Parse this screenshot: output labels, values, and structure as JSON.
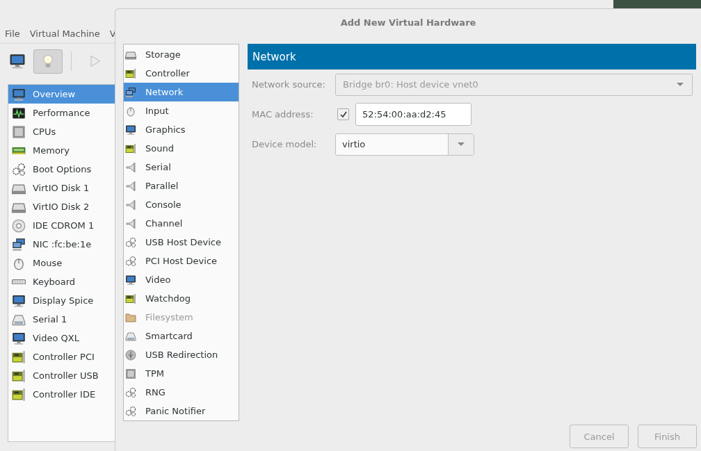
{
  "menu_bar": [
    {
      "label": "File"
    },
    {
      "label": "Virtual Machine"
    },
    {
      "label": "V"
    }
  ],
  "toolbar": [
    {
      "kind": "monitor",
      "selected": false,
      "disabled": false
    },
    {
      "kind": "bulb",
      "selected": true,
      "disabled": false
    },
    {
      "kind": "play",
      "selected": false,
      "disabled": true
    }
  ],
  "sidebar": {
    "items": [
      {
        "label": "Overview",
        "kind": "monitor",
        "selected": true
      },
      {
        "label": "Performance",
        "kind": "chart",
        "selected": false
      },
      {
        "label": "CPUs",
        "kind": "chip",
        "selected": false
      },
      {
        "label": "Memory",
        "kind": "memory",
        "selected": false
      },
      {
        "label": "Boot Options",
        "kind": "gears",
        "selected": false
      },
      {
        "label": "VirtIO Disk 1",
        "kind": "disk",
        "selected": false
      },
      {
        "label": "VirtIO Disk 2",
        "kind": "disk",
        "selected": false
      },
      {
        "label": "IDE CDROM 1",
        "kind": "disc",
        "selected": false
      },
      {
        "label": "NIC :fc:be:1e",
        "kind": "nic",
        "selected": false
      },
      {
        "label": "Mouse",
        "kind": "mouse",
        "selected": false
      },
      {
        "label": "Keyboard",
        "kind": "keyboard",
        "selected": false
      },
      {
        "label": "Display Spice",
        "kind": "monitor",
        "selected": false
      },
      {
        "label": "Serial 1",
        "kind": "serial",
        "selected": false
      },
      {
        "label": "Video QXL",
        "kind": "monitor",
        "selected": false
      },
      {
        "label": "Controller PCI",
        "kind": "card",
        "selected": false
      },
      {
        "label": "Controller USB",
        "kind": "card",
        "selected": false
      },
      {
        "label": "Controller IDE",
        "kind": "card",
        "selected": false
      }
    ]
  },
  "dialog": {
    "title": "Add New Virtual Hardware",
    "device_list": {
      "items": [
        {
          "label": "Storage",
          "kind": "disk",
          "selected": false,
          "disabled": false
        },
        {
          "label": "Controller",
          "kind": "card",
          "selected": false,
          "disabled": false
        },
        {
          "label": "Network",
          "kind": "nic",
          "selected": true,
          "disabled": false
        },
        {
          "label": "Input",
          "kind": "mouse",
          "selected": false,
          "disabled": false
        },
        {
          "label": "Graphics",
          "kind": "monitor",
          "selected": false,
          "disabled": false
        },
        {
          "label": "Sound",
          "kind": "card",
          "selected": false,
          "disabled": false
        },
        {
          "label": "Serial",
          "kind": "plug",
          "selected": false,
          "disabled": false
        },
        {
          "label": "Parallel",
          "kind": "plug",
          "selected": false,
          "disabled": false
        },
        {
          "label": "Console",
          "kind": "plug",
          "selected": false,
          "disabled": false
        },
        {
          "label": "Channel",
          "kind": "plug",
          "selected": false,
          "disabled": false
        },
        {
          "label": "USB Host Device",
          "kind": "gears",
          "selected": false,
          "disabled": false
        },
        {
          "label": "PCI Host Device",
          "kind": "gears",
          "selected": false,
          "disabled": false
        },
        {
          "label": "Video",
          "kind": "monitor",
          "selected": false,
          "disabled": false
        },
        {
          "label": "Watchdog",
          "kind": "card",
          "selected": false,
          "disabled": false
        },
        {
          "label": "Filesystem",
          "kind": "folder",
          "selected": false,
          "disabled": true
        },
        {
          "label": "Smartcard",
          "kind": "serial",
          "selected": false,
          "disabled": false
        },
        {
          "label": "USB Redirection",
          "kind": "usb",
          "selected": false,
          "disabled": false
        },
        {
          "label": "TPM",
          "kind": "chip",
          "selected": false,
          "disabled": false
        },
        {
          "label": "RNG",
          "kind": "gears",
          "selected": false,
          "disabled": false
        },
        {
          "label": "Panic Notifier",
          "kind": "gears",
          "selected": false,
          "disabled": false
        }
      ]
    },
    "panel": {
      "header": "Network",
      "fields": [
        {
          "kind": "combo",
          "label": "Network source:",
          "value": "Bridge br0: Host device vnet0",
          "disabled": true
        },
        {
          "kind": "entry",
          "label": "MAC address:",
          "checked": true,
          "value": "52:54:00:aa:d2:45"
        },
        {
          "kind": "combo-short",
          "label": "Device model:",
          "value": "virtio",
          "disabled": false
        }
      ]
    },
    "buttons": [
      {
        "label": "Cancel",
        "disabled": true
      },
      {
        "label": "Finish",
        "disabled": true
      }
    ]
  }
}
